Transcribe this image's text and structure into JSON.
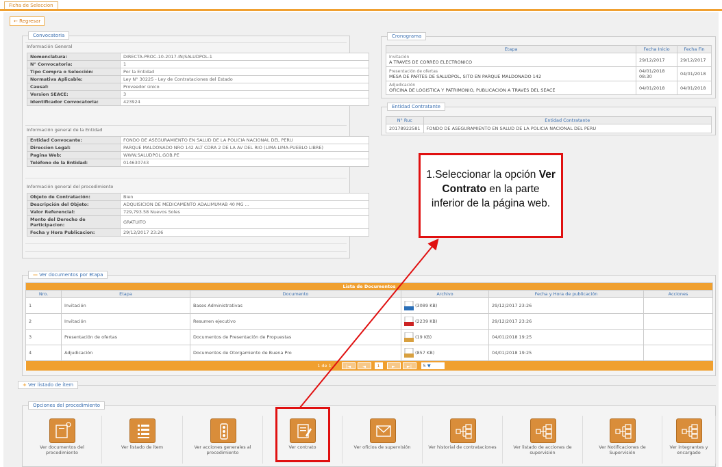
{
  "tab": {
    "label": "Ficha de Seleccion"
  },
  "back": {
    "label": "Regresar"
  },
  "convocatoria": {
    "legend": "Convocatoria",
    "general_title": "Información General",
    "general": [
      {
        "k": "Nomenclatura:",
        "v": "DIRECTA-PROC-10-2017-IN/SALUDPOL-1"
      },
      {
        "k": "N° Convocatoria:",
        "v": "1"
      },
      {
        "k": "Tipo Compra o Selección:",
        "v": "Por la Entidad"
      },
      {
        "k": "Normativa Aplicable:",
        "v": "Ley N° 30225 - Ley de Contrataciones del Estado"
      },
      {
        "k": "Causal:",
        "v": "Proveedor único"
      },
      {
        "k": "Version SEACE:",
        "v": "3"
      },
      {
        "k": "Identificador Convocatoria:",
        "v": "423924"
      }
    ],
    "entidad_title": "Información general de la Entidad",
    "entidad": [
      {
        "k": "Entidad Convocante:",
        "v": "FONDO DE ASEGURAMIENTO EN SALUD DE LA POLICIA NACIONAL DEL PERU"
      },
      {
        "k": "Direccion Legal:",
        "v": "PARQUE MALDONADO NRO 142 ALT CDRA 2 DE LA AV DEL RIO (LIMA-LIMA-PUEBLO LIBRE)"
      },
      {
        "k": "Pagina Web:",
        "v": "WWW.SALUDPOL.GOB.PE"
      },
      {
        "k": "Teléfono de la Entidad:",
        "v": "014630743"
      }
    ],
    "proc_title": "Información general del procedimiento",
    "proc": [
      {
        "k": "Objeto de Contratación:",
        "v": "Bien"
      },
      {
        "k": "Descripción del Objeto:",
        "v": "ADQUISICION DE MEDICAMENTO ADALIMUMAB 40 MG ... "
      },
      {
        "k": "Valor Referencial:",
        "v": "729,793.58 Nuevos Soles"
      },
      {
        "k": "Monto del Derecho de Participacion:",
        "v": "GRATUITO"
      },
      {
        "k": "Fecha y Hora Publicacion:",
        "v": "29/12/2017 23:26"
      }
    ]
  },
  "cronograma": {
    "legend": "Cronograma",
    "headers": [
      "Etapa",
      "Fecha Inicio",
      "Fecha Fin"
    ],
    "rows": [
      {
        "etapa": "Invitación",
        "detalle": "A TRAVES DE CORREO ELECTRONICO",
        "inicio": "29/12/2017",
        "fin": "29/12/2017"
      },
      {
        "etapa": "Presentación de ofertas",
        "detalle": "MESA DE PARTES DE SALUDPOL, SITO EN PARQUE MALDONADO 142",
        "inicio": "04/01/2018 08:30",
        "fin": "04/01/2018"
      },
      {
        "etapa": "Adjudicación",
        "detalle": "OFICINA DE LOGISTICA Y PATRIMONIO, PUBLICACION A TRAVES DEL SEACE",
        "inicio": "04/01/2018",
        "fin": "04/01/2018"
      }
    ]
  },
  "entidad_contratante": {
    "legend": "Entidad Contratante",
    "headers": [
      "N° Ruc",
      "Entidad Contratante"
    ],
    "ruc": "20178922581",
    "nombre": "FONDO DE ASEGURAMIENTO EN SALUD DE LA POLICIA NACIONAL DEL PERU"
  },
  "callout": {
    "pre": "1.Seleccionar la opción ",
    "bold": "Ver Contrato",
    "post": " en la parte inferior de la página web."
  },
  "documentos": {
    "legend": "Ver documentos por Etapa",
    "title": "Lista de Documentos",
    "headers": [
      "Nro.",
      "Etapa",
      "Documento",
      "Archivo",
      "Fecha y Hora de publicación",
      "Acciones"
    ],
    "rows": [
      {
        "nro": "1",
        "etapa": "Invitación",
        "doc": "Bases Administrativas",
        "size": "(3089 KB)",
        "fecha": "29/12/2017 23:26",
        "color": "#2a6fb8"
      },
      {
        "nro": "2",
        "etapa": "Invitación",
        "doc": "Resumen ejecutivo",
        "size": "(2239 KB)",
        "fecha": "29/12/2017 23:26",
        "color": "#cc2222"
      },
      {
        "nro": "3",
        "etapa": "Presentación de ofertas",
        "doc": "Documentos de Presentación de Propuestas",
        "size": "(19 KB)",
        "fecha": "04/01/2018 19:25",
        "color": "#d8a040"
      },
      {
        "nro": "4",
        "etapa": "Adjudicación",
        "doc": "Documentos de Otorgamiento de Buena Pro",
        "size": "(857 KB)",
        "fecha": "04/01/2018 19:25",
        "color": "#d8a040"
      }
    ],
    "pager": {
      "summary": "1 de 1",
      "page": "1",
      "per_page": "5"
    }
  },
  "items": {
    "legend": "Ver listado de ítem"
  },
  "opciones": {
    "legend": "Opciones del procedimiento",
    "items": [
      {
        "label": "Ver documentos del procedimiento",
        "icon": "folder-document-icon"
      },
      {
        "label": "Ver listado de ítem",
        "icon": "list-icon"
      },
      {
        "label": "Ver acciones generales al procedimiento",
        "icon": "traffic-light-icon"
      },
      {
        "label": "Ver contrato",
        "icon": "contract-edit-icon"
      },
      {
        "label": "Ver oficios de supervisión",
        "icon": "envelope-icon"
      },
      {
        "label": "Ver historial de contrataciones",
        "icon": "hierarchy-icon"
      },
      {
        "label": "Ver listado de acciones de supervisión",
        "icon": "hierarchy-icon"
      },
      {
        "label": "Ver Notificaciones de Supervisión",
        "icon": "hierarchy-icon"
      },
      {
        "label": "Ver integrantes y encargado",
        "icon": "hierarchy-icon"
      }
    ]
  }
}
